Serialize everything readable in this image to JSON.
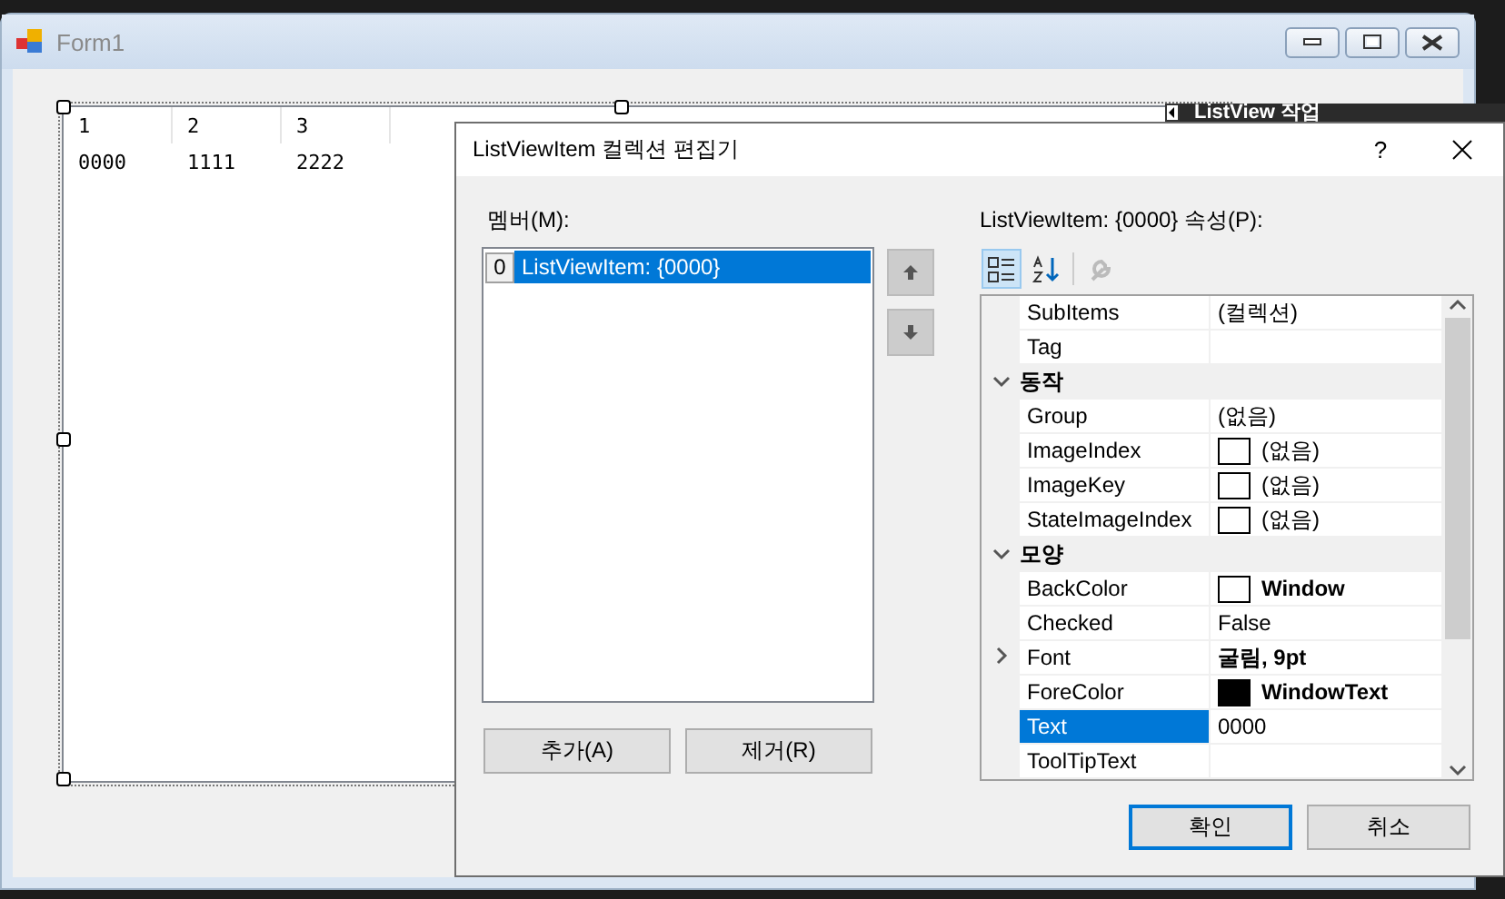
{
  "form": {
    "title": "Form1"
  },
  "listview": {
    "columns": [
      "1",
      "2",
      "3"
    ],
    "rows": [
      [
        "0000",
        "1111",
        "2222"
      ]
    ]
  },
  "smart_tag": {
    "title": "ListView 작업"
  },
  "dialog": {
    "title": "ListViewItem 컬렉션 편집기",
    "help": "?",
    "members_label": "멤버(M):",
    "members": [
      {
        "index": "0",
        "label": "ListViewItem: {0000}",
        "selected": true
      }
    ],
    "add_button": "추가(A)",
    "remove_button": "제거(R)",
    "properties_label": "ListViewItem: {0000} 속성(P):",
    "toolbar": [
      {
        "kind": "categorized",
        "selected": true,
        "disabled": false
      },
      {
        "kind": "alphabetical",
        "selected": false,
        "disabled": false
      },
      {
        "kind": "pages",
        "selected": false,
        "disabled": true
      }
    ],
    "grid": [
      {
        "kind": "property",
        "name": "SubItems",
        "value": "(컬렉션)",
        "bold": false,
        "selected": false
      },
      {
        "kind": "property",
        "name": "Tag",
        "selected": false
      },
      {
        "kind": "category",
        "name": "동작",
        "expanded": true
      },
      {
        "kind": "property",
        "name": "Group",
        "value": "(없음)",
        "bold": false,
        "selected": false
      },
      {
        "kind": "property",
        "name": "ImageIndex",
        "value": "(없음)",
        "color": "#ffffff",
        "bold": false,
        "selected": false
      },
      {
        "kind": "property",
        "name": "ImageKey",
        "value": "(없음)",
        "color": "#ffffff",
        "bold": false,
        "selected": false
      },
      {
        "kind": "property",
        "name": "StateImageIndex",
        "value": "(없음)",
        "color": "#ffffff",
        "bold": false,
        "selected": false
      },
      {
        "kind": "category",
        "name": "모양",
        "expanded": true
      },
      {
        "kind": "property",
        "name": "BackColor",
        "value": "Window",
        "color": "#ffffff",
        "bold": true,
        "selected": false
      },
      {
        "kind": "property",
        "name": "Checked",
        "value": "False",
        "bold": false,
        "selected": false
      },
      {
        "kind": "property",
        "name": "Font",
        "value": "굴림, 9pt",
        "bold": true,
        "expanded": false,
        "selected": false
      },
      {
        "kind": "property",
        "name": "ForeColor",
        "value": "WindowText",
        "color": "#000000",
        "bold": true,
        "selected": false
      },
      {
        "kind": "property",
        "name": "Text",
        "value": "0000",
        "bold": false,
        "selected": true
      },
      {
        "kind": "property",
        "name": "ToolTipText",
        "selected": false
      }
    ],
    "ok_button": "확인",
    "cancel_button": "취소"
  }
}
